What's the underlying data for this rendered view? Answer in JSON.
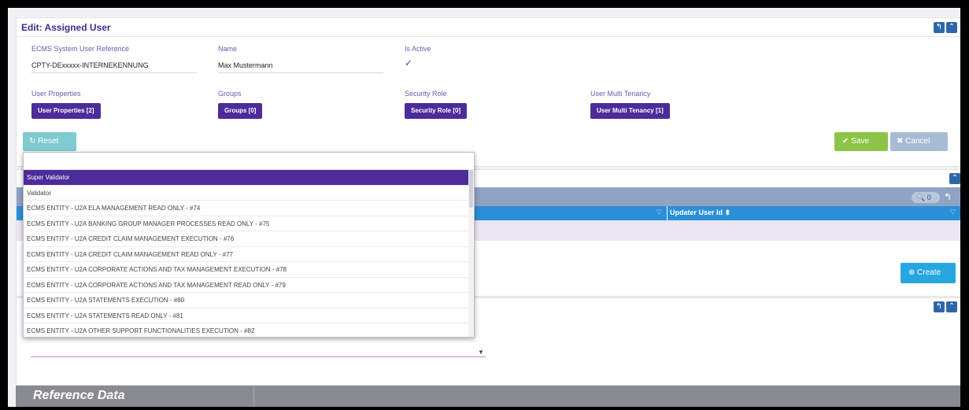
{
  "edit_panel": {
    "title": "Edit: Assigned User",
    "fields": {
      "ecms_ref_label": "ECMS System User Reference",
      "ecms_ref_value": "CPTY-DExxxxx-INTERNEKENNUNG",
      "name_label": "Name",
      "name_value": "Max Mustermann",
      "is_active_label": "Is Active",
      "user_properties_label": "User Properties",
      "groups_label": "Groups",
      "security_role_label": "Security Role",
      "user_multi_tenancy_label": "User Multi Tenancy"
    },
    "buttons": {
      "user_properties": "User Properties [2]",
      "groups": "Groups [0]",
      "security_role": "Security Role [0]",
      "user_multi_tenancy": "User Multi Tenancy [1]",
      "reset": "Reset",
      "save": "Save",
      "cancel": "Cancel"
    }
  },
  "panel2": {
    "search_count": "0",
    "column_updater": "Updater User Id ⬍",
    "create": "Create"
  },
  "reference_data": {
    "label": "Reference Data"
  },
  "dropdown": {
    "items": [
      "Super Validator",
      "Validator",
      "ECMS ENTITY - U2A ELA MANAGEMENT READ ONLY - #74",
      "ECMS ENTITY - U2A BANKING GROUP MANAGER PROCESSES READ ONLY - #75",
      "ECMS ENTITY - U2A CREDIT CLAIM MANAGEMENT EXECUTION - #76",
      "ECMS ENTITY - U2A CREDIT CLAIM MANAGEMENT READ ONLY - #77",
      "ECMS ENTITY - U2A CORPORATE ACTIONS AND TAX MANAGEMENT EXECUTION - #78",
      "ECMS ENTITY - U2A CORPORATE ACTIONS AND TAX MANAGEMENT READ ONLY - #79",
      "ECMS ENTITY - U2A STATEMENTS EXECUTION - #80",
      "ECMS ENTITY - U2A STATEMENTS READ ONLY - #81",
      "ECMS ENTITY - U2A OTHER SUPPORT FUNCTIONALITIES EXECUTION - #82"
    ],
    "selected_index": 0
  },
  "colors": {
    "brand_purple": "#4b2c99",
    "save_green": "#8cc447",
    "create_blue": "#27a6e0"
  }
}
